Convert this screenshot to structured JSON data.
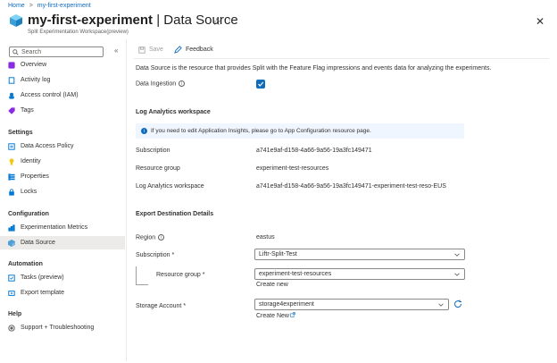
{
  "breadcrumb": {
    "home": "Home",
    "current": "my-first-experiment",
    "separator": ">"
  },
  "header": {
    "title_bold": "my-first-experiment",
    "title_rest": " | Data Source",
    "subtitle": "Split Experimentation Workspace(preview)",
    "star": "☆",
    "more": "···",
    "close": "✕"
  },
  "sidebar": {
    "search_placeholder": "Search",
    "collapse": "«",
    "top_items": [
      {
        "label": "Overview",
        "icon": "overview-icon",
        "color": "#8a2be2"
      },
      {
        "label": "Activity log",
        "icon": "activity-log-icon",
        "color": "#0078d4"
      },
      {
        "label": "Access control (IAM)",
        "icon": "access-control-icon",
        "color": "#0078d4"
      },
      {
        "label": "Tags",
        "icon": "tag-icon",
        "color": "#8a2be2"
      }
    ],
    "settings_heading": "Settings",
    "settings_items": [
      {
        "label": "Data Access Policy",
        "icon": "data-access-policy-icon",
        "color": "#0078d4"
      },
      {
        "label": "Identity",
        "icon": "identity-icon",
        "color": "#f2c811"
      },
      {
        "label": "Properties",
        "icon": "properties-icon",
        "color": "#0078d4"
      },
      {
        "label": "Locks",
        "icon": "lock-icon",
        "color": "#0078d4"
      }
    ],
    "configuration_heading": "Configuration",
    "configuration_items": [
      {
        "label": "Experimentation Metrics",
        "icon": "metrics-icon",
        "color": "#0078d4"
      },
      {
        "label": "Data Source",
        "icon": "data-source-icon",
        "color": "#50a0d8",
        "active": true
      }
    ],
    "automation_heading": "Automation",
    "automation_items": [
      {
        "label": "Tasks (preview)",
        "icon": "tasks-icon",
        "color": "#0078d4"
      },
      {
        "label": "Export template",
        "icon": "export-template-icon",
        "color": "#0078d4"
      }
    ],
    "help_heading": "Help",
    "help_items": [
      {
        "label": "Support + Troubleshooting",
        "icon": "support-icon",
        "color": "#605e5c"
      }
    ]
  },
  "toolbar": {
    "save_label": "Save",
    "feedback_label": "Feedback"
  },
  "main": {
    "description": "Data Source is the resource that provides Split with the Feature Flag impressions and events data for analyzing the experiments.",
    "data_ingestion_label": "Data Ingestion",
    "data_ingestion_checked": true,
    "log_analytics": {
      "heading": "Log Analytics workspace",
      "banner_text": "If you need to edit Application Insights, please go to App Configuration resource page.",
      "subscription_label": "Subscription",
      "subscription_value": "a741e9af-d158-4a66-9a56-19a3fc149471",
      "resource_group_label": "Resource group",
      "resource_group_value": "experiment-test-resources",
      "workspace_label": "Log Analytics workspace",
      "workspace_value": "a741e9af-d158-4a66-9a56-19a3fc149471-experiment-test-reso-EUS"
    },
    "export": {
      "heading": "Export Destination Details",
      "region_label": "Region",
      "region_value": "eastus",
      "subscription_label": "Subscription *",
      "subscription_value": "Liftr-Split-Test",
      "resource_group_label": "Resource group *",
      "resource_group_value": "experiment-test-resources",
      "create_new": "Create new",
      "storage_label": "Storage Account *",
      "storage_value": "storage4experiment",
      "create_new_storage": "Create New"
    }
  }
}
